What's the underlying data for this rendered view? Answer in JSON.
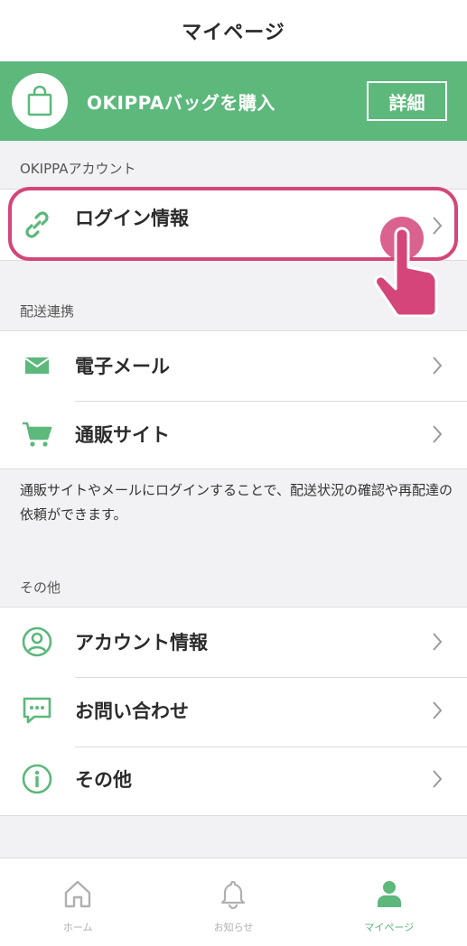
{
  "header": {
    "title": "マイページ"
  },
  "banner": {
    "text": "OKIPPAバッグを購入",
    "detail_label": "詳細",
    "icon": "shopping-bag-icon",
    "color": "#5cb87b"
  },
  "sections": {
    "account": {
      "header": "OKIPPAアカウント",
      "items": [
        {
          "label": "ログイン情報",
          "icon": "link-icon"
        }
      ]
    },
    "delivery": {
      "header": "配送連携",
      "items": [
        {
          "label": "電子メール",
          "icon": "mail-icon"
        },
        {
          "label": "通販サイト",
          "icon": "cart-icon"
        }
      ],
      "note": "通販サイトやメールにログインすることで、配送状況の確認や再配達の依頼ができます。"
    },
    "other": {
      "header": "その他",
      "items": [
        {
          "label": "アカウント情報",
          "icon": "account-circle-icon"
        },
        {
          "label": "お問い合わせ",
          "icon": "chat-bubble-icon"
        },
        {
          "label": "その他",
          "icon": "info-icon"
        }
      ]
    }
  },
  "tabbar": {
    "items": [
      {
        "label": "ホーム",
        "icon": "home-icon",
        "active": false
      },
      {
        "label": "お知らせ",
        "icon": "bell-icon",
        "active": false
      },
      {
        "label": "マイページ",
        "icon": "person-icon",
        "active": true
      }
    ]
  },
  "colors": {
    "accent": "#5cb87b",
    "highlight": "#d4467a"
  }
}
